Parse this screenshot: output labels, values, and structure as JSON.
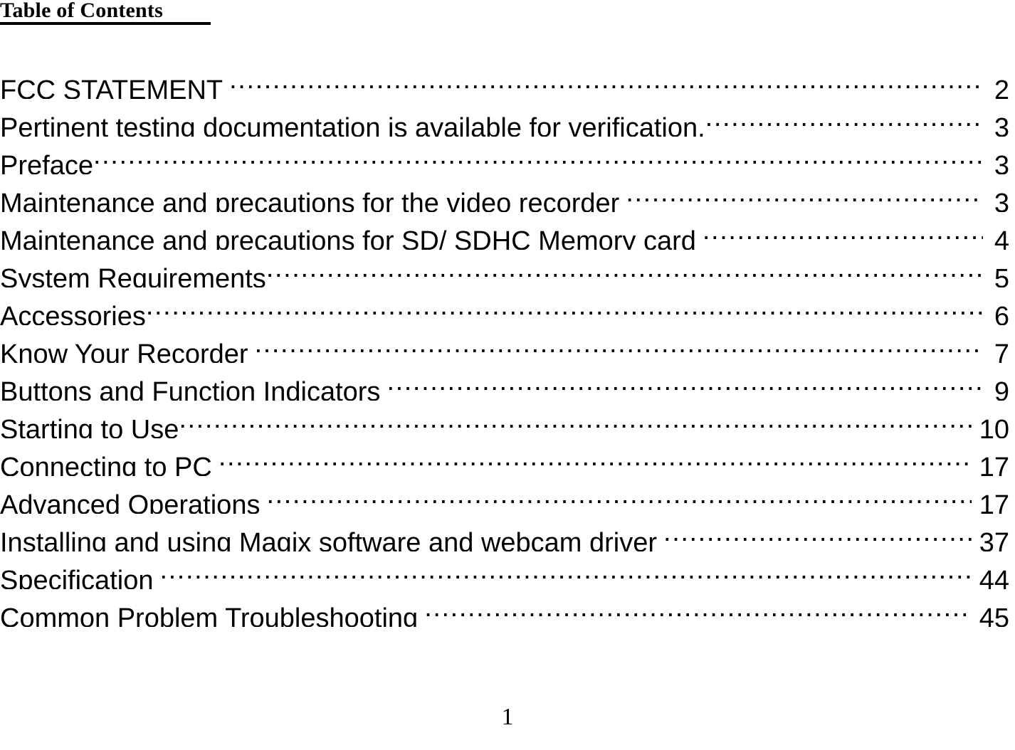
{
  "document": {
    "title": "Table of Contents",
    "footer_page_number": "1"
  },
  "toc": {
    "entries": [
      {
        "label": "FCC STATEMENT",
        "page": "2",
        "spacing": "gap"
      },
      {
        "label": "Pertinent testing documentation is available for verification.",
        "page": "3",
        "spacing": "tight"
      },
      {
        "label": "Preface",
        "page": "3",
        "spacing": "tight"
      },
      {
        "label": "Maintenance and precautions for the video recorder",
        "page": "3",
        "spacing": "gap"
      },
      {
        "label": "Maintenance and precautions for SD/ SDHC Memory card",
        "page": "4",
        "spacing": "gap"
      },
      {
        "label": "System Requirements",
        "page": "5",
        "spacing": "tight"
      },
      {
        "label": "Accessories",
        "page": "6",
        "spacing": "tight"
      },
      {
        "label": "Know Your Recorder",
        "page": "7",
        "spacing": "gap"
      },
      {
        "label": "Buttons and Function Indicators",
        "page": "9",
        "spacing": "gap"
      },
      {
        "label": "Starting to Use",
        "page": "10",
        "spacing": "tight"
      },
      {
        "label": "Connecting to PC",
        "page": "17",
        "spacing": "gap"
      },
      {
        "label": "Advanced Operations",
        "page": "17",
        "spacing": "gap"
      },
      {
        "label": "Installing and using Magix software and webcam driver",
        "page": "37",
        "spacing": "gap"
      },
      {
        "label": "Specification",
        "page": "44",
        "spacing": "gap"
      },
      {
        "label": "Common Problem Troubleshooting",
        "page": "45",
        "spacing": "gap"
      }
    ]
  }
}
